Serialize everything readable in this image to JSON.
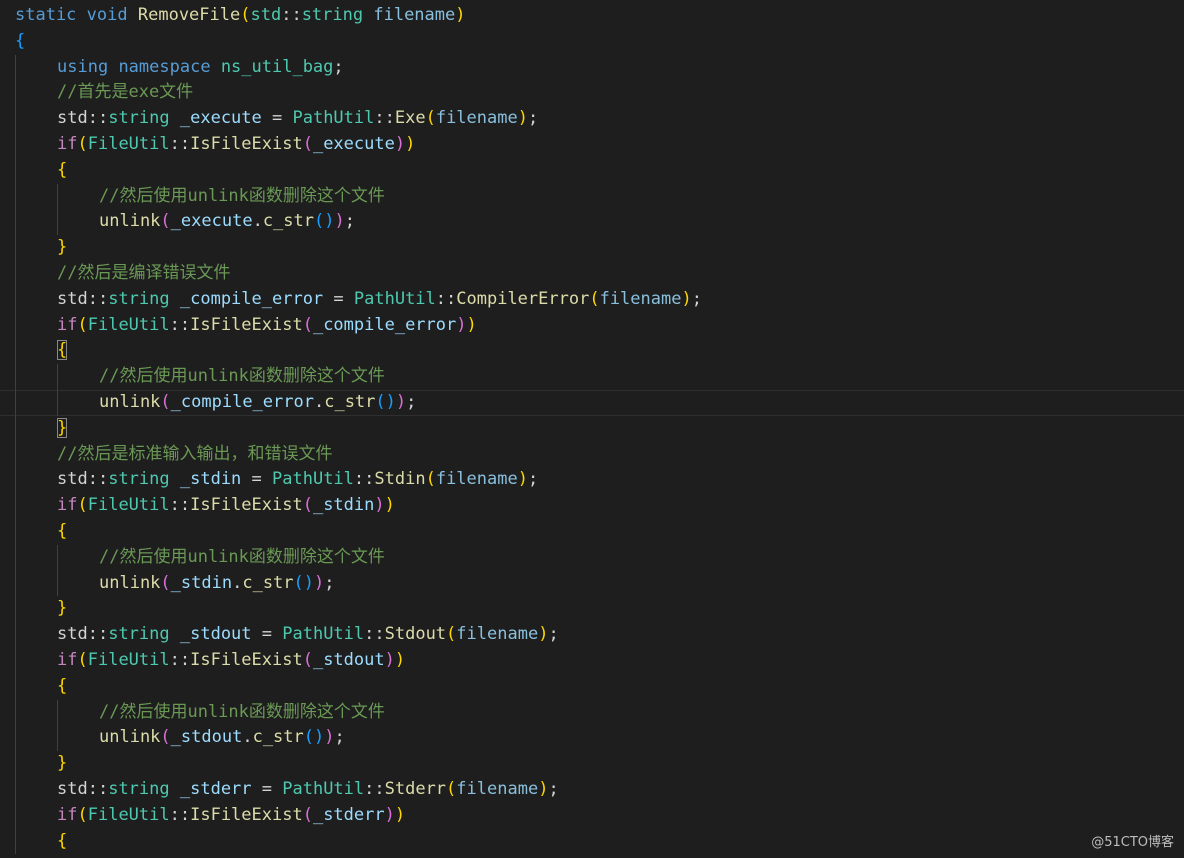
{
  "editor": {
    "lines": [
      {
        "indent": 0,
        "tokens": [
          [
            "static",
            "kw"
          ],
          [
            " ",
            ""
          ],
          [
            "void",
            "kw"
          ],
          [
            " ",
            ""
          ],
          [
            "RemoveFile",
            "fn"
          ],
          [
            "(",
            "b1"
          ],
          [
            "std",
            "type"
          ],
          [
            "::",
            "punc"
          ],
          [
            "string",
            "type"
          ],
          [
            " ",
            ""
          ],
          [
            "filename",
            "param"
          ],
          [
            ")",
            "b1"
          ]
        ]
      },
      {
        "indent": 0,
        "tokens": [
          [
            "{",
            "b3"
          ]
        ]
      },
      {
        "indent": 1,
        "tokens": [
          [
            "using",
            "kw"
          ],
          [
            " ",
            ""
          ],
          [
            "namespace",
            "kw"
          ],
          [
            " ",
            ""
          ],
          [
            "ns_util_bag",
            "ns"
          ],
          [
            ";",
            "punc"
          ]
        ]
      },
      {
        "indent": 1,
        "tokens": [
          [
            "//首先是exe文件",
            "com"
          ]
        ]
      },
      {
        "indent": 1,
        "tokens": [
          [
            "std",
            "punc"
          ],
          [
            "::",
            "punc"
          ],
          [
            "string",
            "type"
          ],
          [
            " ",
            ""
          ],
          [
            "_execute",
            "var"
          ],
          [
            " = ",
            ""
          ],
          [
            "PathUtil",
            "type"
          ],
          [
            "::",
            "punc"
          ],
          [
            "Exe",
            "fn"
          ],
          [
            "(",
            "b1"
          ],
          [
            "filename",
            "param"
          ],
          [
            ")",
            "b1"
          ],
          [
            ";",
            "punc"
          ]
        ]
      },
      {
        "indent": 1,
        "tokens": [
          [
            "if",
            "ctl"
          ],
          [
            "(",
            "b1"
          ],
          [
            "FileUtil",
            "type"
          ],
          [
            "::",
            "punc"
          ],
          [
            "IsFileExist",
            "fn"
          ],
          [
            "(",
            "b2"
          ],
          [
            "_execute",
            "var"
          ],
          [
            ")",
            "b2"
          ],
          [
            ")",
            "b1"
          ]
        ]
      },
      {
        "indent": 1,
        "tokens": [
          [
            "{",
            "b1"
          ]
        ]
      },
      {
        "indent": 2,
        "tokens": [
          [
            "//然后使用unlink函数删除这个文件",
            "com"
          ]
        ]
      },
      {
        "indent": 2,
        "tokens": [
          [
            "unlink",
            "fn"
          ],
          [
            "(",
            "b2"
          ],
          [
            "_execute",
            "var"
          ],
          [
            ".",
            "punc"
          ],
          [
            "c_str",
            "fn"
          ],
          [
            "(",
            "b3"
          ],
          [
            ")",
            "b3"
          ],
          [
            ")",
            "b2"
          ],
          [
            ";",
            "punc"
          ]
        ]
      },
      {
        "indent": 1,
        "tokens": [
          [
            "}",
            "b1"
          ]
        ]
      },
      {
        "indent": 1,
        "tokens": [
          [
            "//然后是编译错误文件",
            "com"
          ]
        ]
      },
      {
        "indent": 1,
        "tokens": [
          [
            "std",
            "punc"
          ],
          [
            "::",
            "punc"
          ],
          [
            "string",
            "type"
          ],
          [
            " ",
            ""
          ],
          [
            "_compile_error",
            "var"
          ],
          [
            " = ",
            ""
          ],
          [
            "PathUtil",
            "type"
          ],
          [
            "::",
            "punc"
          ],
          [
            "CompilerError",
            "fn"
          ],
          [
            "(",
            "b1"
          ],
          [
            "filename",
            "param"
          ],
          [
            ")",
            "b1"
          ],
          [
            ";",
            "punc"
          ]
        ]
      },
      {
        "indent": 1,
        "tokens": [
          [
            "if",
            "ctl"
          ],
          [
            "(",
            "b1"
          ],
          [
            "FileUtil",
            "type"
          ],
          [
            "::",
            "punc"
          ],
          [
            "IsFileExist",
            "fn"
          ],
          [
            "(",
            "b2"
          ],
          [
            "_compile_error",
            "var"
          ],
          [
            ")",
            "b2"
          ],
          [
            ")",
            "b1"
          ]
        ]
      },
      {
        "indent": 1,
        "tokens": [
          [
            "{",
            "bm"
          ]
        ]
      },
      {
        "indent": 2,
        "tokens": [
          [
            "//然后使用unlink函数删除这个文件",
            "com"
          ]
        ]
      },
      {
        "indent": 2,
        "current": true,
        "tokens": [
          [
            "unlink",
            "fn"
          ],
          [
            "(",
            "b2"
          ],
          [
            "_compile_error",
            "var"
          ],
          [
            ".",
            "punc"
          ],
          [
            "c_str",
            "fn"
          ],
          [
            "(",
            "b3"
          ],
          [
            ")",
            "b3"
          ],
          [
            ")",
            "b2"
          ],
          [
            ";",
            "punc"
          ]
        ]
      },
      {
        "indent": 1,
        "tokens": [
          [
            "}",
            "bm"
          ]
        ]
      },
      {
        "indent": 1,
        "tokens": [
          [
            "//然后是标准输入输出，和错误文件",
            "com"
          ]
        ]
      },
      {
        "indent": 1,
        "tokens": [
          [
            "std",
            "punc"
          ],
          [
            "::",
            "punc"
          ],
          [
            "string",
            "type"
          ],
          [
            " ",
            ""
          ],
          [
            "_stdin",
            "var"
          ],
          [
            " = ",
            ""
          ],
          [
            "PathUtil",
            "type"
          ],
          [
            "::",
            "punc"
          ],
          [
            "Stdin",
            "fn"
          ],
          [
            "(",
            "b1"
          ],
          [
            "filename",
            "param"
          ],
          [
            ")",
            "b1"
          ],
          [
            ";",
            "punc"
          ]
        ]
      },
      {
        "indent": 1,
        "tokens": [
          [
            "if",
            "ctl"
          ],
          [
            "(",
            "b1"
          ],
          [
            "FileUtil",
            "type"
          ],
          [
            "::",
            "punc"
          ],
          [
            "IsFileExist",
            "fn"
          ],
          [
            "(",
            "b2"
          ],
          [
            "_stdin",
            "var"
          ],
          [
            ")",
            "b2"
          ],
          [
            ")",
            "b1"
          ]
        ]
      },
      {
        "indent": 1,
        "tokens": [
          [
            "{",
            "b1"
          ]
        ]
      },
      {
        "indent": 2,
        "tokens": [
          [
            "//然后使用unlink函数删除这个文件",
            "com"
          ]
        ]
      },
      {
        "indent": 2,
        "tokens": [
          [
            "unlink",
            "fn"
          ],
          [
            "(",
            "b2"
          ],
          [
            "_stdin",
            "var"
          ],
          [
            ".",
            "punc"
          ],
          [
            "c_str",
            "fn"
          ],
          [
            "(",
            "b3"
          ],
          [
            ")",
            "b3"
          ],
          [
            ")",
            "b2"
          ],
          [
            ";",
            "punc"
          ]
        ]
      },
      {
        "indent": 1,
        "tokens": [
          [
            "}",
            "b1"
          ]
        ]
      },
      {
        "indent": 1,
        "tokens": [
          [
            "std",
            "punc"
          ],
          [
            "::",
            "punc"
          ],
          [
            "string",
            "type"
          ],
          [
            " ",
            ""
          ],
          [
            "_stdout",
            "var"
          ],
          [
            " = ",
            ""
          ],
          [
            "PathUtil",
            "type"
          ],
          [
            "::",
            "punc"
          ],
          [
            "Stdout",
            "fn"
          ],
          [
            "(",
            "b1"
          ],
          [
            "filename",
            "param"
          ],
          [
            ")",
            "b1"
          ],
          [
            ";",
            "punc"
          ]
        ]
      },
      {
        "indent": 1,
        "tokens": [
          [
            "if",
            "ctl"
          ],
          [
            "(",
            "b1"
          ],
          [
            "FileUtil",
            "type"
          ],
          [
            "::",
            "punc"
          ],
          [
            "IsFileExist",
            "fn"
          ],
          [
            "(",
            "b2"
          ],
          [
            "_stdout",
            "var"
          ],
          [
            ")",
            "b2"
          ],
          [
            ")",
            "b1"
          ]
        ]
      },
      {
        "indent": 1,
        "tokens": [
          [
            "{",
            "b1"
          ]
        ]
      },
      {
        "indent": 2,
        "tokens": [
          [
            "//然后使用unlink函数删除这个文件",
            "com"
          ]
        ]
      },
      {
        "indent": 2,
        "tokens": [
          [
            "unlink",
            "fn"
          ],
          [
            "(",
            "b2"
          ],
          [
            "_stdout",
            "var"
          ],
          [
            ".",
            "punc"
          ],
          [
            "c_str",
            "fn"
          ],
          [
            "(",
            "b3"
          ],
          [
            ")",
            "b3"
          ],
          [
            ")",
            "b2"
          ],
          [
            ";",
            "punc"
          ]
        ]
      },
      {
        "indent": 1,
        "tokens": [
          [
            "}",
            "b1"
          ]
        ]
      },
      {
        "indent": 1,
        "tokens": [
          [
            "std",
            "punc"
          ],
          [
            "::",
            "punc"
          ],
          [
            "string",
            "type"
          ],
          [
            " ",
            ""
          ],
          [
            "_stderr",
            "var"
          ],
          [
            " = ",
            ""
          ],
          [
            "PathUtil",
            "type"
          ],
          [
            "::",
            "punc"
          ],
          [
            "Stderr",
            "fn"
          ],
          [
            "(",
            "b1"
          ],
          [
            "filename",
            "param"
          ],
          [
            ")",
            "b1"
          ],
          [
            ";",
            "punc"
          ]
        ]
      },
      {
        "indent": 1,
        "tokens": [
          [
            "if",
            "ctl"
          ],
          [
            "(",
            "b1"
          ],
          [
            "FileUtil",
            "type"
          ],
          [
            "::",
            "punc"
          ],
          [
            "IsFileExist",
            "fn"
          ],
          [
            "(",
            "b2"
          ],
          [
            "_stderr",
            "var"
          ],
          [
            ")",
            "b2"
          ],
          [
            ")",
            "b1"
          ]
        ]
      },
      {
        "indent": 1,
        "tokens": [
          [
            "{",
            "b1"
          ]
        ]
      }
    ]
  },
  "watermark": {
    "text": "@51CTO博客"
  },
  "colors": {
    "background": "#1e1e1e",
    "keyword": "#569cd6",
    "control": "#c586c0",
    "type": "#4ec9b0",
    "function": "#dcdcaa",
    "variable": "#9cdcfe",
    "comment": "#6a9955",
    "bracket_level1": "#ffd700",
    "bracket_level2": "#da70d6",
    "bracket_level3": "#179fff"
  }
}
